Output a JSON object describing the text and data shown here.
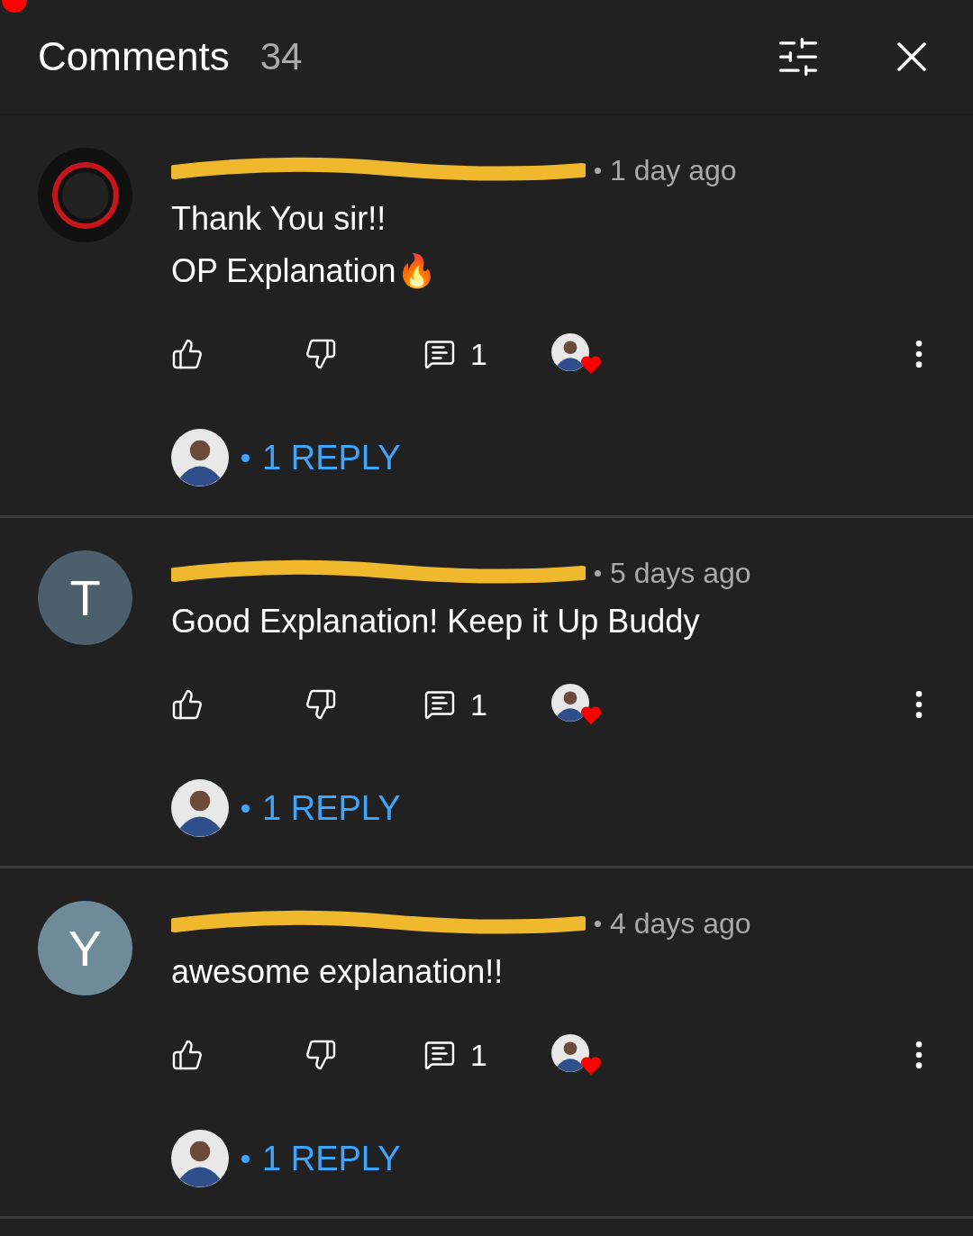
{
  "header": {
    "title": "Comments",
    "count": "34"
  },
  "comments": [
    {
      "avatar": {
        "kind": "logo"
      },
      "time": "1 day ago",
      "lines": [
        "Thank You sir!!",
        "OP Explanation🔥"
      ],
      "reply_count": "1",
      "hearted": true,
      "replies_link": "1 REPLY"
    },
    {
      "avatar": {
        "kind": "letter",
        "letter": "T",
        "color": "#4b5f6c"
      },
      "time": "5 days ago",
      "lines": [
        "Good Explanation! Keep it Up Buddy"
      ],
      "reply_count": "1",
      "hearted": true,
      "replies_link": "1 REPLY"
    },
    {
      "avatar": {
        "kind": "letter",
        "letter": "Y",
        "color": "#6f8b99"
      },
      "time": "4 days ago",
      "lines": [
        "awesome explanation!!"
      ],
      "reply_count": "1",
      "hearted": true,
      "replies_link": "1 REPLY"
    }
  ]
}
